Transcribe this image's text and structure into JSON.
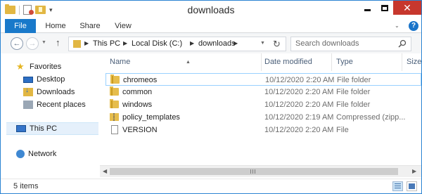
{
  "window": {
    "title": "downloads"
  },
  "ribbon": {
    "tabs": [
      "File",
      "Home",
      "Share",
      "View"
    ]
  },
  "addressbar": {
    "crumbs": [
      "This PC",
      "Local Disk (C:)",
      "downloads"
    ]
  },
  "search": {
    "placeholder": "Search downloads"
  },
  "navpane": {
    "favorites_label": "Favorites",
    "favorites": [
      "Desktop",
      "Downloads",
      "Recent places"
    ],
    "this_pc": "This PC",
    "network": "Network"
  },
  "columns": {
    "name": "Name",
    "date": "Date modified",
    "type": "Type",
    "size": "Size"
  },
  "files": [
    {
      "name": "chromeos",
      "date": "10/12/2020 2:20 AM",
      "type": "File folder",
      "icon": "folder-icon"
    },
    {
      "name": "common",
      "date": "10/12/2020 2:20 AM",
      "type": "File folder",
      "icon": "folder-icon"
    },
    {
      "name": "windows",
      "date": "10/12/2020 2:20 AM",
      "type": "File folder",
      "icon": "folder-icon"
    },
    {
      "name": "policy_templates",
      "date": "10/12/2020 2:19 AM",
      "type": "Compressed (zipp...",
      "icon": "zip-folder-icon"
    },
    {
      "name": "VERSION",
      "date": "10/12/2020 2:20 AM",
      "type": "File",
      "icon": "file-icon"
    }
  ],
  "status": {
    "item_count": "5 items"
  },
  "colors": {
    "accent": "#1979ca",
    "close": "#c7372d",
    "folder": "#e6bd4c",
    "selection_border": "#99d1ff"
  }
}
